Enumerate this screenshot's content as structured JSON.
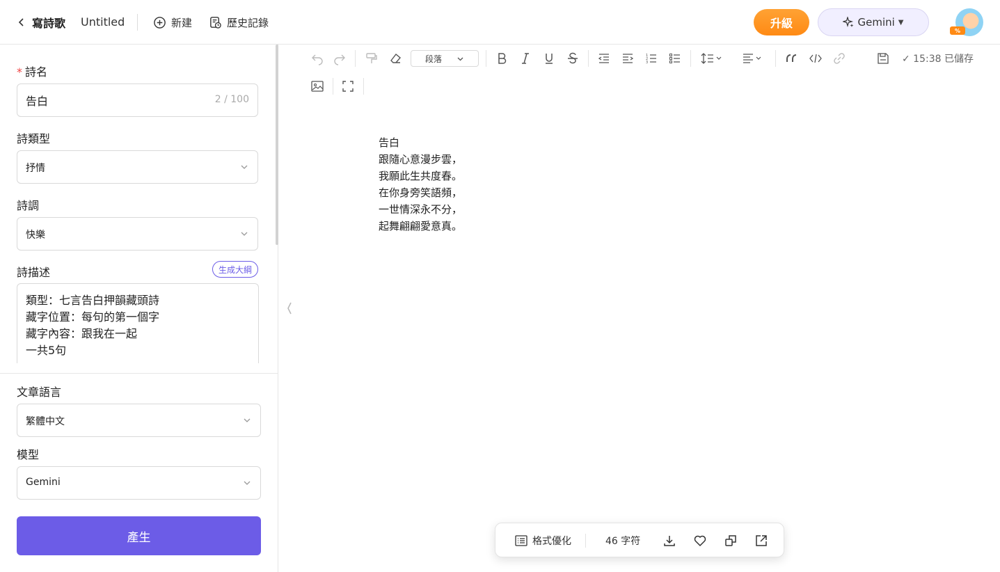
{
  "header": {
    "app_title": "寫詩歌",
    "doc_title": "Untitled",
    "new_label": "新建",
    "history_label": "歷史記錄",
    "upgrade_label": "升級",
    "model_label": "Gemini",
    "avatar_badge": "%"
  },
  "form": {
    "poem_name": {
      "label": "詩名",
      "value": "告白",
      "counter": "2 / 100"
    },
    "poem_type": {
      "label": "詩類型",
      "value": "抒情"
    },
    "poem_tone": {
      "label": "詩調",
      "value": "快樂"
    },
    "poem_description": {
      "label": "詩描述",
      "outline_button": "生成大綱",
      "value": "類型：七言告白押韻藏頭詩\n藏字位置：每句的第一個字\n藏字內容：跟我在一起\n一共5句"
    },
    "language": {
      "label": "文章語言",
      "value": "繁體中文"
    },
    "model": {
      "label": "模型",
      "value": "Gemini"
    },
    "generate_label": "產生"
  },
  "toolbar": {
    "paragraph_select": "段落",
    "save_status": "✓ 15:38 已儲存"
  },
  "editor": {
    "lines": [
      "告白",
      "跟隨心意漫步雲，",
      "我願此生共度春。",
      "在你身旁笑語頻，",
      "一世情深永不分，",
      "起舞翩翩愛意真。"
    ]
  },
  "bottom_bar": {
    "format_label": "格式優化",
    "char_count": "46 字符"
  },
  "colors": {
    "accent": "#6c5ce7",
    "upgrade": "#ff8a14",
    "required": "#ef4444"
  },
  "icons": [
    "chevron-left-icon",
    "plus-circle-icon",
    "history-icon",
    "sparkle-icon",
    "undo-icon",
    "redo-icon",
    "format-painter-icon",
    "eraser-icon",
    "bold-icon",
    "italic-icon",
    "underline-icon",
    "strikethrough-icon",
    "outdent-icon",
    "indent-icon",
    "ordered-list-icon",
    "bullet-list-icon",
    "line-height-icon",
    "align-icon",
    "quote-icon",
    "code-icon",
    "link-icon",
    "save-icon",
    "image-icon",
    "fullscreen-icon",
    "list-icon",
    "download-icon",
    "heart-icon",
    "copy-icon",
    "share-icon"
  ]
}
